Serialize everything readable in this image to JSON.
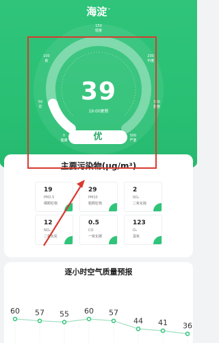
{
  "header": {
    "city": "海淀",
    "chevron": "˅"
  },
  "gauge": {
    "aqi": "39",
    "update_time": "19:00更新",
    "grade": "优",
    "progress_fraction": 0.13,
    "scale": [
      {
        "value": "0",
        "label": "健康"
      },
      {
        "value": "50",
        "label": "优"
      },
      {
        "value": "100",
        "label": "良"
      },
      {
        "value": "150",
        "label": "轻度"
      },
      {
        "value": "200",
        "label": "中度"
      },
      {
        "value": "300",
        "label": "重度"
      },
      {
        "value": "500",
        "label": "严重"
      }
    ]
  },
  "pollutants": {
    "title": "主要污染物(μg/m³)",
    "items": [
      {
        "value": "19",
        "name": "PM2.5",
        "cn": "细颗粒物"
      },
      {
        "value": "29",
        "name": "PM10",
        "cn": "粗颗粒物"
      },
      {
        "value": "2",
        "name": "SO₂",
        "cn": "二氧化硫"
      },
      {
        "value": "12",
        "name": "NO₂",
        "cn": "二氧化氮"
      },
      {
        "value": "0.5",
        "name": "CO",
        "cn": "一氧化碳"
      },
      {
        "value": "123",
        "name": "O₃",
        "cn": "臭氧"
      }
    ]
  },
  "forecast": {
    "title": "逐小时空气质量预报",
    "values": [
      60,
      57,
      55,
      60,
      57,
      44,
      41,
      36
    ]
  },
  "colors": {
    "primary_green": "#2fc47a",
    "annotation_red": "#d83a30"
  }
}
